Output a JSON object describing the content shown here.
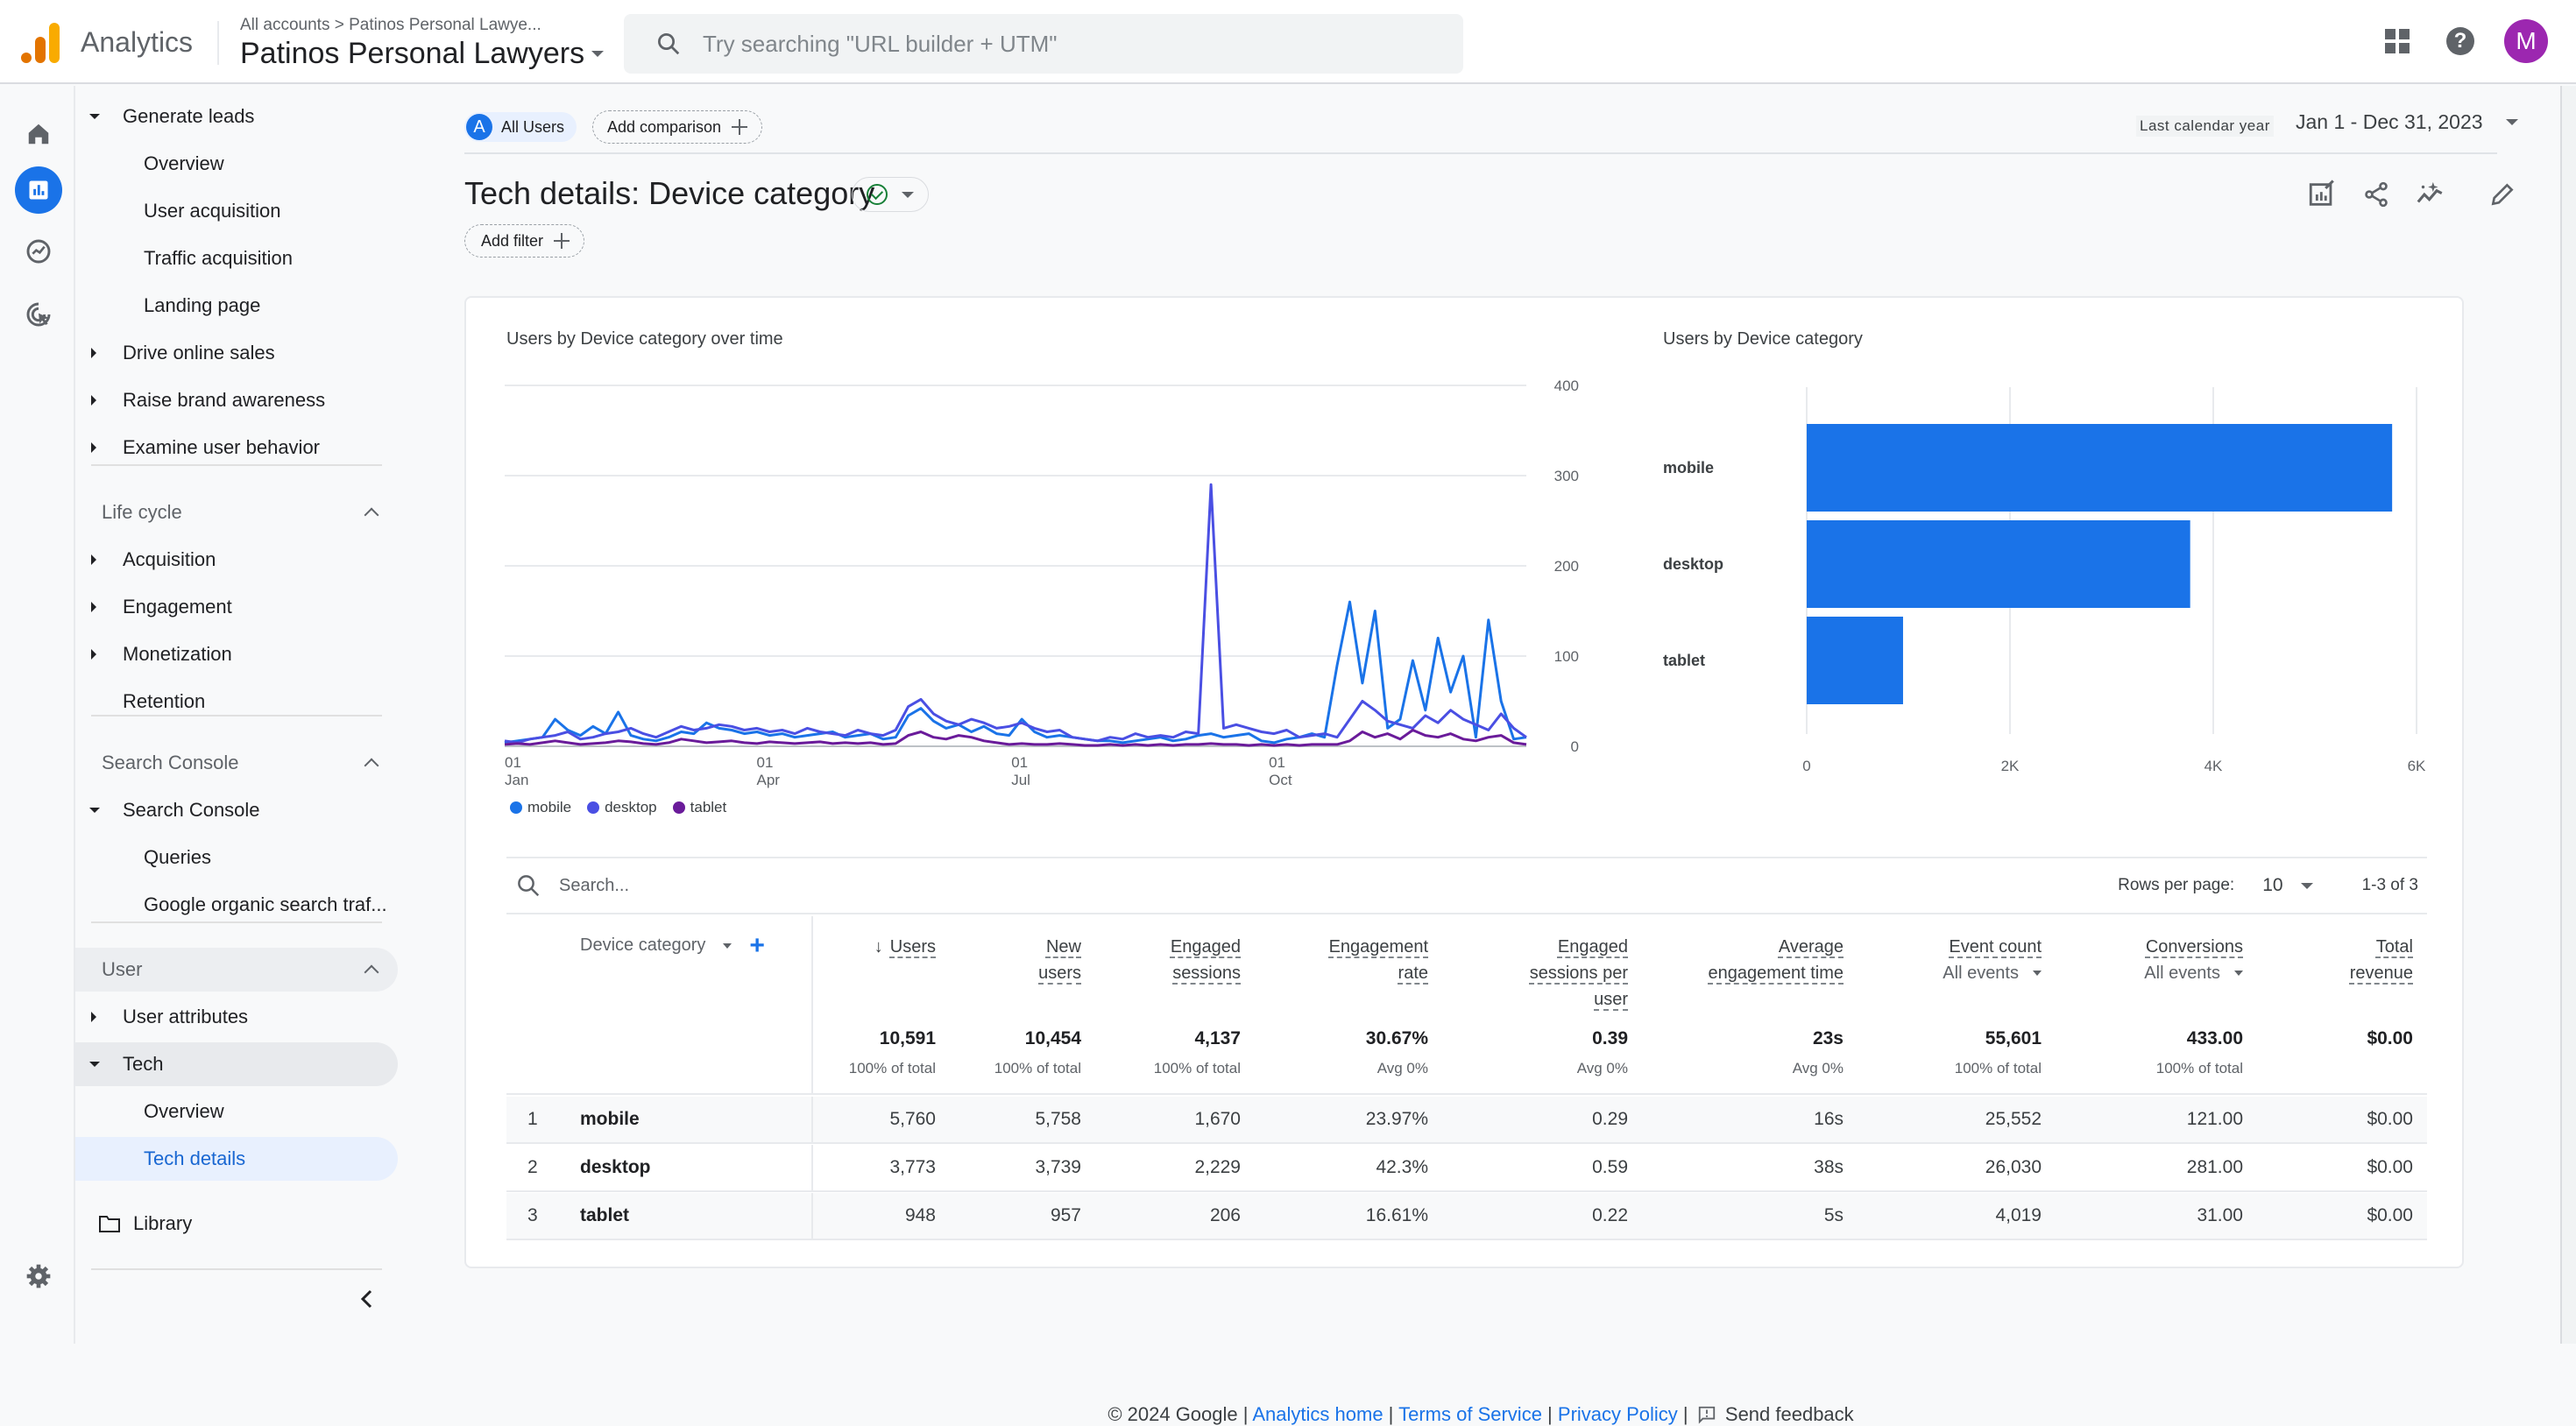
{
  "header": {
    "app_name": "Analytics",
    "breadcrumb": "All accounts > Patinos Personal Lawye...",
    "property_name": "Patinos Personal Lawyers",
    "search_placeholder": "Try searching \"URL builder + UTM\"",
    "avatar_letter": "M",
    "icons": [
      "apps-grid-icon",
      "help-icon"
    ]
  },
  "rail": {
    "icons": [
      "home-icon",
      "reports-icon",
      "explore-icon",
      "advertising-icon",
      "settings-icon"
    ],
    "active": "reports-icon"
  },
  "nav": {
    "items": [
      {
        "label": "Generate leads",
        "type": "group",
        "expanded": true
      },
      {
        "label": "Overview",
        "type": "child"
      },
      {
        "label": "User acquisition",
        "type": "child"
      },
      {
        "label": "Traffic acquisition",
        "type": "child"
      },
      {
        "label": "Landing page",
        "type": "child"
      },
      {
        "label": "Drive online sales",
        "type": "group",
        "expanded": false
      },
      {
        "label": "Raise brand awareness",
        "type": "group",
        "expanded": false
      },
      {
        "label": "Examine user behavior",
        "type": "group",
        "expanded": false
      },
      {
        "label": "Life cycle",
        "type": "section"
      },
      {
        "label": "Acquisition",
        "type": "group",
        "expanded": false
      },
      {
        "label": "Engagement",
        "type": "group",
        "expanded": false
      },
      {
        "label": "Monetization",
        "type": "group",
        "expanded": false
      },
      {
        "label": "Retention",
        "type": "leaf"
      },
      {
        "label": "Search Console",
        "type": "section"
      },
      {
        "label": "Search Console",
        "type": "group",
        "expanded": true
      },
      {
        "label": "Queries",
        "type": "child"
      },
      {
        "label": "Google organic search traf...",
        "type": "child"
      },
      {
        "label": "User",
        "type": "section"
      },
      {
        "label": "User attributes",
        "type": "group",
        "expanded": false
      },
      {
        "label": "Tech",
        "type": "group",
        "expanded": true
      },
      {
        "label": "Overview",
        "type": "child"
      },
      {
        "label": "Tech details",
        "type": "child",
        "active": true
      }
    ],
    "library_label": "Library"
  },
  "main": {
    "segment_letter": "A",
    "segment_label": "All Users",
    "add_comparison_label": "Add comparison",
    "date_preset_label": "Last calendar year",
    "date_range": "Jan 1 - Dec 31, 2023",
    "page_title": "Tech details: Device category",
    "add_filter_label": "Add filter",
    "toolbar_icons": [
      "customize-report-icon",
      "share-icon",
      "insights-icon",
      "edit-icon"
    ]
  },
  "chart_data": [
    {
      "type": "line",
      "title": "Users by Device category over time",
      "x_ticks": [
        {
          "day": "01",
          "month": "Jan"
        },
        {
          "day": "01",
          "month": "Apr"
        },
        {
          "day": "01",
          "month": "Jul"
        },
        {
          "day": "01",
          "month": "Oct"
        }
      ],
      "xlim": [
        "2023-01-01",
        "2023-12-31"
      ],
      "y_ticks": [
        "0",
        "100",
        "200",
        "300",
        "400"
      ],
      "ylim": [
        0,
        400
      ],
      "y_axis_side": "right",
      "grid": true,
      "legend_position": "bottom-left",
      "series": [
        {
          "name": "mobile",
          "color": "#1a73e8",
          "weekly_values": [
            4,
            6,
            8,
            10,
            30,
            18,
            12,
            22,
            14,
            38,
            12,
            8,
            6,
            10,
            16,
            14,
            26,
            20,
            18,
            14,
            16,
            12,
            14,
            10,
            12,
            14,
            16,
            10,
            12,
            14,
            8,
            10,
            34,
            42,
            28,
            20,
            24,
            16,
            22,
            14,
            12,
            30,
            16,
            10,
            12,
            10,
            8,
            6,
            6,
            4,
            6,
            8,
            10,
            6,
            8,
            12,
            14,
            10,
            12,
            14,
            6,
            4,
            8,
            10,
            14,
            10,
            90,
            160,
            70,
            150,
            20,
            30,
            95,
            40,
            120,
            60,
            100,
            10,
            140,
            50,
            8,
            10
          ]
        },
        {
          "name": "desktop",
          "color": "#4a4fe3",
          "weekly_values": [
            6,
            4,
            8,
            10,
            12,
            16,
            8,
            10,
            14,
            16,
            20,
            14,
            10,
            16,
            22,
            18,
            20,
            24,
            22,
            18,
            20,
            16,
            18,
            14,
            20,
            16,
            14,
            12,
            18,
            14,
            12,
            18,
            44,
            52,
            36,
            28,
            24,
            30,
            26,
            20,
            22,
            26,
            20,
            16,
            18,
            10,
            8,
            6,
            10,
            8,
            14,
            10,
            12,
            10,
            16,
            14,
            290,
            20,
            24,
            20,
            16,
            14,
            18,
            10,
            12,
            14,
            10,
            30,
            50,
            40,
            28,
            24,
            20,
            34,
            26,
            40,
            30,
            24,
            18,
            36,
            20,
            10
          ]
        },
        {
          "name": "tablet",
          "color": "#6a1b9a",
          "weekly_values": [
            2,
            3,
            2,
            4,
            6,
            4,
            2,
            3,
            4,
            6,
            5,
            3,
            2,
            4,
            8,
            6,
            4,
            5,
            6,
            4,
            3,
            5,
            4,
            3,
            4,
            5,
            3,
            4,
            3,
            4,
            2,
            3,
            12,
            16,
            10,
            8,
            12,
            10,
            6,
            4,
            2,
            3,
            2,
            2,
            3,
            2,
            1,
            1,
            2,
            1,
            2,
            1,
            2,
            1,
            2,
            2,
            3,
            2,
            2,
            1,
            2,
            1,
            2,
            1,
            2,
            2,
            2,
            6,
            16,
            10,
            14,
            8,
            18,
            12,
            10,
            14,
            8,
            6,
            10,
            12,
            4,
            2
          ]
        }
      ]
    },
    {
      "type": "bar",
      "orientation": "horizontal",
      "title": "Users by Device category",
      "categories": [
        "mobile",
        "desktop",
        "tablet"
      ],
      "values": [
        5760,
        3773,
        948
      ],
      "color": "#1a73e8",
      "x_ticks": [
        "0",
        "2K",
        "4K",
        "6K"
      ],
      "xlim": [
        0,
        6000
      ],
      "grid": true
    }
  ],
  "legend": [
    {
      "name": "mobile",
      "color": "#1a73e8"
    },
    {
      "name": "desktop",
      "color": "#4a4fe3"
    },
    {
      "name": "tablet",
      "color": "#6a1b9a"
    }
  ],
  "table": {
    "search_placeholder": "Search...",
    "rows_per_page_label": "Rows per page:",
    "rows_per_page_value": "10",
    "pagination": "1-3 of 3",
    "dimension_header": "Device category",
    "columns": [
      {
        "title": [
          "Users"
        ],
        "sorted": true,
        "total": "10,591",
        "total_sub": "100% of total"
      },
      {
        "title": [
          "New",
          "users"
        ],
        "total": "10,454",
        "total_sub": "100% of total"
      },
      {
        "title": [
          "Engaged",
          "sessions"
        ],
        "total": "4,137",
        "total_sub": "100% of total"
      },
      {
        "title": [
          "Engagement",
          "rate"
        ],
        "total": "30.67%",
        "total_sub": "Avg 0%"
      },
      {
        "title": [
          "Engaged",
          "sessions per",
          "user"
        ],
        "total": "0.39",
        "total_sub": "Avg 0%"
      },
      {
        "title": [
          "Average",
          "engagement time"
        ],
        "total": "23s",
        "total_sub": "Avg 0%"
      },
      {
        "title": [
          "Event count"
        ],
        "selector": "All events",
        "total": "55,601",
        "total_sub": "100% of total"
      },
      {
        "title": [
          "Conversions"
        ],
        "selector": "All events",
        "total": "433.00",
        "total_sub": "100% of total"
      },
      {
        "title": [
          "Total",
          "revenue"
        ],
        "total": "$0.00",
        "total_sub": ""
      }
    ],
    "rows": [
      {
        "index": "1",
        "dimension": "mobile",
        "values": [
          "5,760",
          "5,758",
          "1,670",
          "23.97%",
          "0.29",
          "16s",
          "25,552",
          "121.00",
          "$0.00"
        ]
      },
      {
        "index": "2",
        "dimension": "desktop",
        "values": [
          "3,773",
          "3,739",
          "2,229",
          "42.3%",
          "0.59",
          "38s",
          "26,030",
          "281.00",
          "$0.00"
        ]
      },
      {
        "index": "3",
        "dimension": "tablet",
        "values": [
          "948",
          "957",
          "206",
          "16.61%",
          "0.22",
          "5s",
          "4,019",
          "31.00",
          "$0.00"
        ]
      }
    ]
  },
  "footer": {
    "copyright": "© 2024 Google |",
    "links": [
      "Analytics home",
      "Terms of Service",
      "Privacy Policy"
    ],
    "feedback_label": "Send feedback"
  }
}
